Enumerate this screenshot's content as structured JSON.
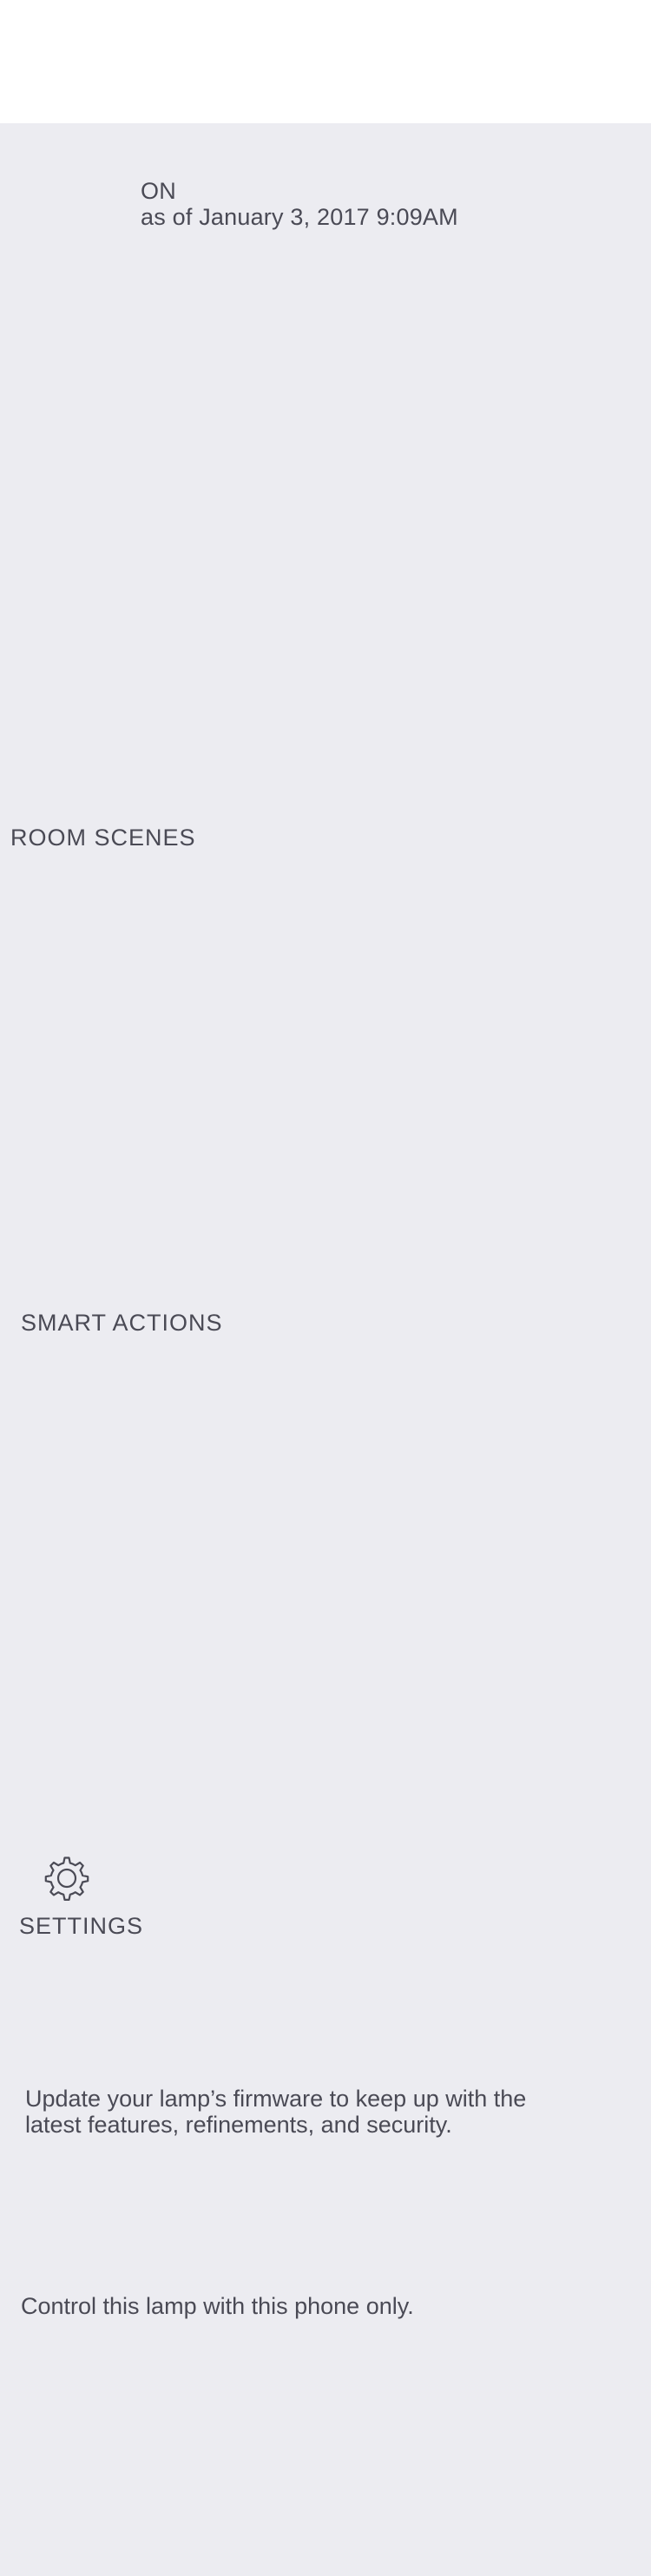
{
  "status": {
    "state": "ON",
    "as_of": "as of January 3, 2017 9:09AM"
  },
  "sections": {
    "room_scenes": "ROOM SCENES",
    "smart_actions": "SMART ACTIONS",
    "settings": "SETTINGS"
  },
  "settings_panel": {
    "icon": "gear-icon",
    "firmware_line_1": "Update your lamp’s firmware to keep up with the",
    "firmware_line_2": "latest features, refinements, and security.",
    "control_text": "Control this lamp with this phone only."
  },
  "colors": {
    "background": "#ececf1",
    "header": "#ffffff",
    "text": "#4a4a55"
  }
}
